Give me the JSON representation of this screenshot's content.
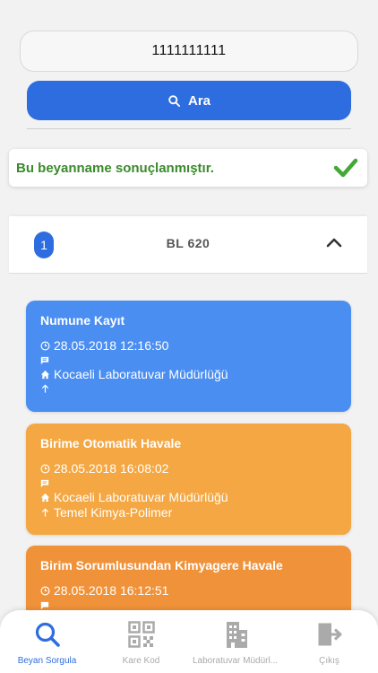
{
  "search": {
    "value": "1111111111",
    "button_label": "Ara"
  },
  "result_message": "Bu beyanname sonuçlanmıştır.",
  "panel": {
    "index": "1",
    "title": "BL 620"
  },
  "events": [
    {
      "title": "Numune Kayıt",
      "datetime": "28.05.2018 12:16:50",
      "location": "Kocaeli Laboratuvar Müdürlüğü",
      "target": ""
    },
    {
      "title": "Birime Otomatik Havale",
      "datetime": "28.05.2018 16:08:02",
      "location": "Kocaeli Laboratuvar Müdürlüğü",
      "target": "Temel Kimya-Polimer"
    },
    {
      "title": "Birim Sorumlusundan Kimyagere Havale",
      "datetime": "28.05.2018 16:12:51",
      "location": "",
      "target": ""
    }
  ],
  "colors": {
    "primary": "#2e6ddf",
    "card_blue": "#4a8ef2",
    "card_orange_light": "#f4a742",
    "card_orange": "#f0923a",
    "success": "#3b8a2c",
    "nav_inactive": "#aaaaaa"
  },
  "nav": [
    {
      "label": "Beyan Sorgula",
      "icon": "search-icon",
      "active": true
    },
    {
      "label": "Kare Kod",
      "icon": "qr-code-icon",
      "active": false
    },
    {
      "label": "Laboratuvar Müdürl...",
      "icon": "building-icon",
      "active": false
    },
    {
      "label": "Çıkış",
      "icon": "logout-icon",
      "active": false
    }
  ]
}
